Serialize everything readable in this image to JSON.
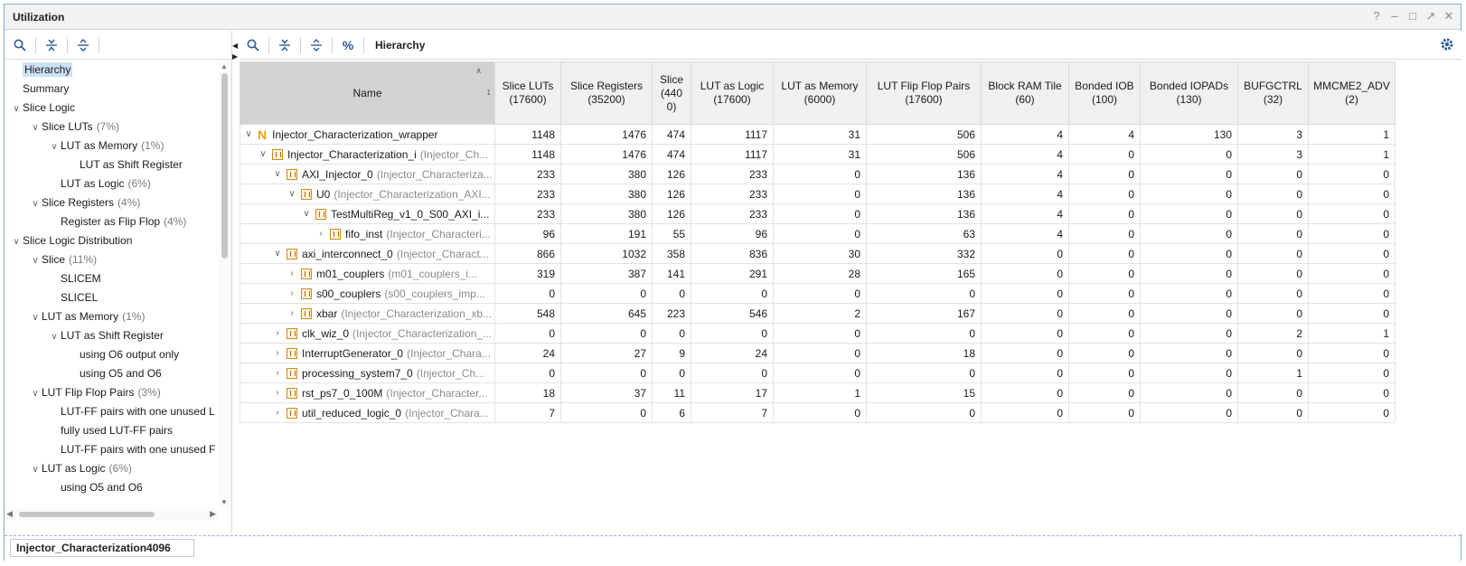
{
  "window": {
    "title": "Utilization",
    "controls": [
      "help-icon",
      "minimize-icon",
      "maximize-icon",
      "float-icon",
      "close-icon"
    ]
  },
  "left_toolbar": {
    "icons": [
      "search-icon",
      "collapse-all-icon",
      "expand-all-icon"
    ]
  },
  "tree": [
    {
      "label": "Hierarchy",
      "pct": "",
      "depth": 0,
      "chev": "",
      "selected": true
    },
    {
      "label": "Summary",
      "pct": "",
      "depth": 0,
      "chev": ""
    },
    {
      "label": "Slice Logic",
      "pct": "",
      "depth": 0,
      "chev": "open"
    },
    {
      "label": "Slice LUTs",
      "pct": "(7%)",
      "depth": 1,
      "chev": "open"
    },
    {
      "label": "LUT as Memory",
      "pct": "(1%)",
      "depth": 2,
      "chev": "open"
    },
    {
      "label": "LUT as Shift Register",
      "pct": "",
      "depth": 3,
      "chev": ""
    },
    {
      "label": "LUT as Logic",
      "pct": "(6%)",
      "depth": 2,
      "chev": ""
    },
    {
      "label": "Slice Registers",
      "pct": "(4%)",
      "depth": 1,
      "chev": "open"
    },
    {
      "label": "Register as Flip Flop",
      "pct": "(4%)",
      "depth": 2,
      "chev": ""
    },
    {
      "label": "Slice Logic Distribution",
      "pct": "",
      "depth": 0,
      "chev": "open"
    },
    {
      "label": "Slice",
      "pct": "(11%)",
      "depth": 1,
      "chev": "open"
    },
    {
      "label": "SLICEM",
      "pct": "",
      "depth": 2,
      "chev": ""
    },
    {
      "label": "SLICEL",
      "pct": "",
      "depth": 2,
      "chev": ""
    },
    {
      "label": "LUT as Memory",
      "pct": "(1%)",
      "depth": 1,
      "chev": "open"
    },
    {
      "label": "LUT as Shift Register",
      "pct": "",
      "depth": 2,
      "chev": "open"
    },
    {
      "label": "using O6 output only",
      "pct": "",
      "depth": 3,
      "chev": ""
    },
    {
      "label": "using O5 and O6",
      "pct": "",
      "depth": 3,
      "chev": ""
    },
    {
      "label": "LUT Flip Flop Pairs",
      "pct": "(3%)",
      "depth": 1,
      "chev": "open"
    },
    {
      "label": "LUT-FF pairs with one unused L",
      "pct": "",
      "depth": 2,
      "chev": ""
    },
    {
      "label": "fully used LUT-FF pairs",
      "pct": "",
      "depth": 2,
      "chev": ""
    },
    {
      "label": "LUT-FF pairs with one unused F",
      "pct": "",
      "depth": 2,
      "chev": ""
    },
    {
      "label": "LUT as Logic",
      "pct": "(6%)",
      "depth": 1,
      "chev": "open"
    },
    {
      "label": "using O5 and O6",
      "pct": "",
      "depth": 2,
      "chev": ""
    }
  ],
  "right_toolbar": {
    "icons": [
      "search-icon",
      "collapse-all-icon",
      "expand-all-icon",
      "percent-icon"
    ],
    "label": "Hierarchy",
    "settings_icon": "gear-icon"
  },
  "table": {
    "columns": [
      "Name",
      "Slice LUTs\n(17600)",
      "Slice Registers\n(35200)",
      "Slice\n(440\n0)",
      "LUT as Logic\n(17600)",
      "LUT as Memory\n(6000)",
      "LUT Flip Flop Pairs\n(17600)",
      "Block RAM Tile\n(60)",
      "Bonded IOB\n(100)",
      "Bonded IOPADs\n(130)",
      "BUFGCTRL\n(32)",
      "MMCME2_ADV\n(2)"
    ],
    "sort_index": "1",
    "rows": [
      {
        "depth": 0,
        "chev": "open",
        "icon": "N",
        "inst": "Injector_Characterization_wrapper",
        "mod": "",
        "vals": [
          "1148",
          "1476",
          "474",
          "1117",
          "31",
          "506",
          "4",
          "4",
          "130",
          "3",
          "1"
        ]
      },
      {
        "depth": 1,
        "chev": "open",
        "icon": "cell",
        "inst": "Injector_Characterization_i",
        "mod": "(Injector_Ch...",
        "vals": [
          "1148",
          "1476",
          "474",
          "1117",
          "31",
          "506",
          "4",
          "0",
          "0",
          "3",
          "1"
        ]
      },
      {
        "depth": 2,
        "chev": "open",
        "icon": "cell",
        "inst": "AXI_Injector_0",
        "mod": "(Injector_Characteriza...",
        "vals": [
          "233",
          "380",
          "126",
          "233",
          "0",
          "136",
          "4",
          "0",
          "0",
          "0",
          "0"
        ]
      },
      {
        "depth": 3,
        "chev": "open",
        "icon": "cell",
        "inst": "U0",
        "mod": "(Injector_Characterization_AXI...",
        "vals": [
          "233",
          "380",
          "126",
          "233",
          "0",
          "136",
          "4",
          "0",
          "0",
          "0",
          "0"
        ]
      },
      {
        "depth": 4,
        "chev": "open",
        "icon": "cell",
        "inst": "TestMultiReg_v1_0_S00_AXI_i...",
        "mod": "",
        "vals": [
          "233",
          "380",
          "126",
          "233",
          "0",
          "136",
          "4",
          "0",
          "0",
          "0",
          "0"
        ]
      },
      {
        "depth": 5,
        "chev": "closed",
        "icon": "cell",
        "inst": "fifo_inst",
        "mod": "(Injector_Characteri...",
        "vals": [
          "96",
          "191",
          "55",
          "96",
          "0",
          "63",
          "4",
          "0",
          "0",
          "0",
          "0"
        ]
      },
      {
        "depth": 2,
        "chev": "open",
        "icon": "cell",
        "inst": "axi_interconnect_0",
        "mod": "(Injector_Charact...",
        "vals": [
          "866",
          "1032",
          "358",
          "836",
          "30",
          "332",
          "0",
          "0",
          "0",
          "0",
          "0"
        ]
      },
      {
        "depth": 3,
        "chev": "closed",
        "icon": "cell",
        "inst": "m01_couplers",
        "mod": "(m01_couplers_i...",
        "vals": [
          "319",
          "387",
          "141",
          "291",
          "28",
          "165",
          "0",
          "0",
          "0",
          "0",
          "0"
        ]
      },
      {
        "depth": 3,
        "chev": "closed",
        "icon": "cell",
        "inst": "s00_couplers",
        "mod": "(s00_couplers_imp...",
        "vals": [
          "0",
          "0",
          "0",
          "0",
          "0",
          "0",
          "0",
          "0",
          "0",
          "0",
          "0"
        ]
      },
      {
        "depth": 3,
        "chev": "closed",
        "icon": "cell",
        "inst": "xbar",
        "mod": "(Injector_Characterization_xb...",
        "vals": [
          "548",
          "645",
          "223",
          "546",
          "2",
          "167",
          "0",
          "0",
          "0",
          "0",
          "0"
        ]
      },
      {
        "depth": 2,
        "chev": "closed",
        "icon": "cell",
        "inst": "clk_wiz_0",
        "mod": "(Injector_Characterization_...",
        "vals": [
          "0",
          "0",
          "0",
          "0",
          "0",
          "0",
          "0",
          "0",
          "0",
          "2",
          "1"
        ]
      },
      {
        "depth": 2,
        "chev": "closed",
        "icon": "cell",
        "inst": "InterruptGenerator_0",
        "mod": "(Injector_Chara...",
        "vals": [
          "24",
          "27",
          "9",
          "24",
          "0",
          "18",
          "0",
          "0",
          "0",
          "0",
          "0"
        ]
      },
      {
        "depth": 2,
        "chev": "closed",
        "icon": "cell",
        "inst": "processing_system7_0",
        "mod": "(Injector_Ch...",
        "vals": [
          "0",
          "0",
          "0",
          "0",
          "0",
          "0",
          "0",
          "0",
          "0",
          "1",
          "0"
        ]
      },
      {
        "depth": 2,
        "chev": "closed",
        "icon": "cell",
        "inst": "rst_ps7_0_100M",
        "mod": "(Injector_Character...",
        "vals": [
          "18",
          "37",
          "11",
          "17",
          "1",
          "15",
          "0",
          "0",
          "0",
          "0",
          "0"
        ]
      },
      {
        "depth": 2,
        "chev": "closed",
        "icon": "cell",
        "inst": "util_reduced_logic_0",
        "mod": "(Injector_Chara...",
        "vals": [
          "7",
          "0",
          "6",
          "7",
          "0",
          "0",
          "0",
          "0",
          "0",
          "0",
          "0"
        ]
      }
    ]
  },
  "bottom": {
    "field_value": "Injector_Characterization4096"
  },
  "colors": {
    "selection": "#cce0f6",
    "header_bg": "#f0f0f0",
    "name_header_bg": "#d2d2d2",
    "cell_icon": "#d08a1b",
    "n_icon": "#e7a21b"
  }
}
